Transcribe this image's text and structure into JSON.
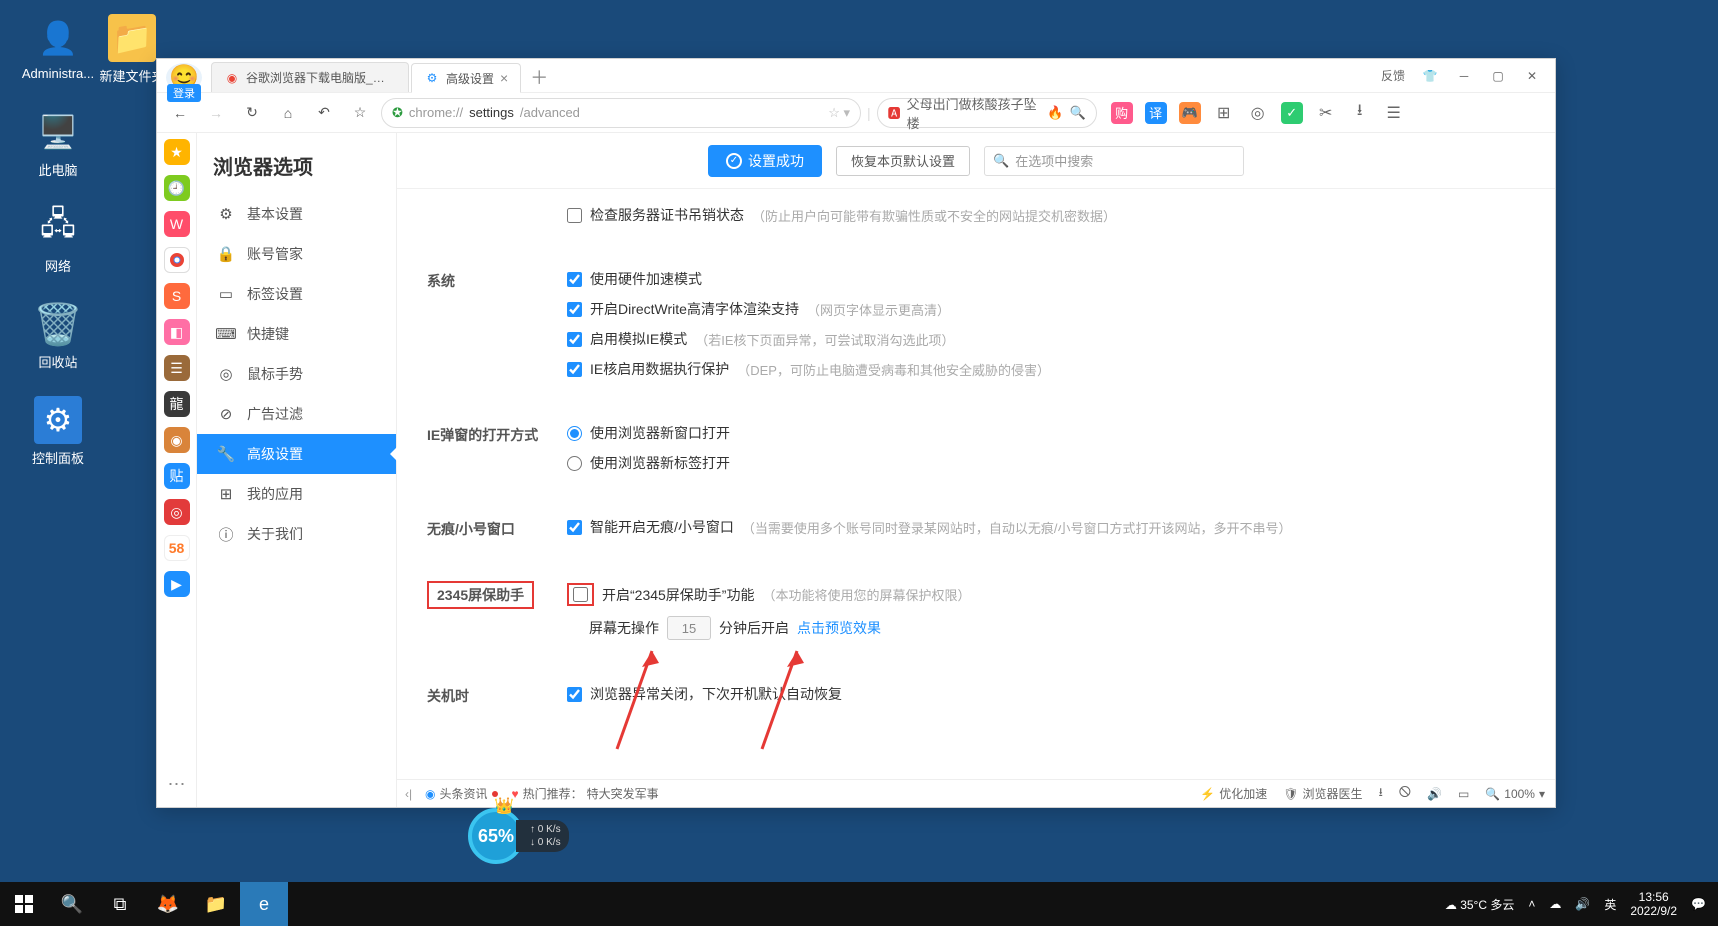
{
  "desktop": {
    "icons": [
      {
        "label": "Administra...",
        "type": "user"
      },
      {
        "label": "新建文件夹",
        "type": "folder"
      },
      {
        "label": "此电脑",
        "type": "pc"
      },
      {
        "label": "网络",
        "type": "net"
      },
      {
        "label": "回收站",
        "type": "bin"
      },
      {
        "label": "控制面板",
        "type": "panel"
      }
    ]
  },
  "browser": {
    "login_label": "登录",
    "tabs": [
      {
        "title": "谷歌浏览器下载电脑版_谷歌浏…",
        "active": false,
        "favicon_color": "#ea4335"
      },
      {
        "title": "高级设置",
        "active": true,
        "favicon_color": "#1e90ff"
      }
    ],
    "window_feedback": "反馈",
    "address": {
      "scheme": "chrome://",
      "path_bold": "settings",
      "path_rest": "/advanced"
    },
    "search_hot": "父母出门做核酸孩子坠楼",
    "toolbar_icons": [
      {
        "name": "shop",
        "bg": "#ff5a8c",
        "text": "购"
      },
      {
        "name": "translate",
        "bg": "#1e90ff",
        "text": "译"
      },
      {
        "name": "game",
        "bg": "#ff8b3d",
        "text": "🎮"
      },
      {
        "name": "apps",
        "plain": true,
        "text": "⊞"
      },
      {
        "name": "target",
        "plain": true,
        "text": "◎"
      },
      {
        "name": "2345",
        "bg": "#2ecc71",
        "text": "✓"
      },
      {
        "name": "scissors",
        "plain": true,
        "text": "✂"
      },
      {
        "name": "download",
        "plain": true,
        "text": "⭳"
      },
      {
        "name": "menu",
        "plain": true,
        "text": "☰"
      }
    ],
    "sidebar_mini": [
      {
        "bg": "#ffb400",
        "text": "★"
      },
      {
        "bg": "#7ecb20",
        "text": "🕘"
      },
      {
        "bg": "#ff4d6a",
        "text": "W"
      },
      {
        "bg": "#ffffff",
        "text": "",
        "chrome": true
      },
      {
        "bg": "#ff6a3d",
        "text": "S"
      },
      {
        "bg": "#ff6fa5",
        "text": "◧"
      },
      {
        "bg": "#9a6a3a",
        "text": "☰"
      },
      {
        "bg": "#6a3a2a",
        "text": "龍"
      },
      {
        "bg": "#d9843a",
        "text": "◉"
      },
      {
        "bg": "#1e90ff",
        "text": "贴"
      },
      {
        "bg": "#e23b3b",
        "text": "◎"
      },
      {
        "bg": "#ffffff",
        "text": "58",
        "c": "#ff7a2a"
      },
      {
        "bg": "#1e90ff",
        "text": "▶"
      }
    ]
  },
  "settings": {
    "page_title": "浏览器选项",
    "success_label": "设置成功",
    "restore_label": "恢复本页默认设置",
    "search_placeholder": "在选项中搜索",
    "nav": [
      {
        "icon": "⚙",
        "label": "基本设置"
      },
      {
        "icon": "🔒",
        "label": "账号管家"
      },
      {
        "icon": "▭",
        "label": "标签设置"
      },
      {
        "icon": "⌨",
        "label": "快捷键"
      },
      {
        "icon": "◎",
        "label": "鼠标手势"
      },
      {
        "icon": "⊘",
        "label": "广告过滤"
      },
      {
        "icon": "🔧",
        "label": "高级设置",
        "active": true
      },
      {
        "icon": "⊞",
        "label": "我的应用"
      },
      {
        "icon": "ⓘ",
        "label": "关于我们"
      }
    ],
    "sections": {
      "top": {
        "opt": {
          "label": "检查服务器证书吊销状态",
          "hint": "（防止用户向可能带有欺骗性质或不安全的网站提交机密数据）",
          "checked": false
        }
      },
      "system": {
        "label": "系统",
        "opts": [
          {
            "label": "使用硬件加速模式",
            "checked": true
          },
          {
            "label": "开启DirectWrite高清字体渲染支持",
            "hint": "（网页字体显示更高清）",
            "checked": true
          },
          {
            "label": "启用模拟IE模式",
            "hint": "（若IE核下页面异常，可尝试取消勾选此项）",
            "checked": true
          },
          {
            "label": "IE核启用数据执行保护",
            "hint": "（DEP，可防止电脑遭受病毒和其他安全威胁的侵害）",
            "checked": true
          }
        ]
      },
      "ie_popup": {
        "label": "IE弹窗的打开方式",
        "opts": [
          {
            "label": "使用浏览器新窗口打开",
            "checked": true
          },
          {
            "label": "使用浏览器新标签打开",
            "checked": false
          }
        ]
      },
      "incognito": {
        "label": "无痕/小号窗口",
        "opt": {
          "label": "智能开启无痕/小号窗口",
          "hint": "（当需要使用多个账号同时登录某网站时，自动以无痕/小号窗口方式打开该网站，多开不串号）",
          "checked": true
        }
      },
      "screensaver": {
        "label": "2345屏保助手",
        "opt": {
          "label": "开启“2345屏保助手”功能",
          "hint": "（本功能将使用您的屏幕保护权限）",
          "checked": false
        },
        "idle_before": "屏幕无操作",
        "idle_value": "15",
        "idle_after": "分钟后开启",
        "preview_link": "点击预览效果"
      },
      "shutdown": {
        "label": "关机时",
        "opt": {
          "label": "浏览器异常关闭，下次开机默认自动恢复",
          "checked": true
        }
      }
    }
  },
  "footer": {
    "headlines": "头条资讯",
    "hot_prefix": "热门推荐：",
    "hot_text": "特大突发军事",
    "optimize": "优化加速",
    "doctor": "浏览器医生",
    "zoom": "100%"
  },
  "widget": {
    "percent": "65%",
    "up": "0 K/s",
    "down": "0 K/s"
  },
  "taskbar": {
    "weather_temp": "35°C 多云",
    "ime": "英",
    "time": "13:56",
    "date": "2022/9/2"
  }
}
